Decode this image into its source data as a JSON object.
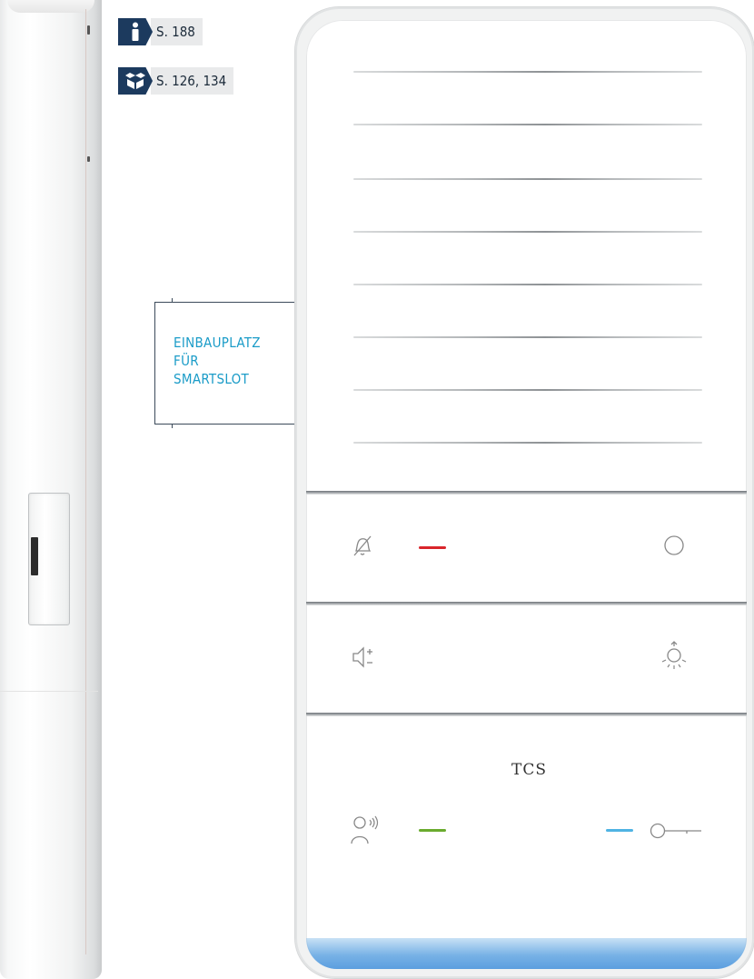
{
  "refs": [
    {
      "icon": "info-icon",
      "text": "S. 188"
    },
    {
      "icon": "package-icon",
      "text": "S. 126, 134"
    }
  ],
  "callout": {
    "label": "EINBAUPLATZ\nFÜR\nSMARTSLOT"
  },
  "device": {
    "brand": "TCS",
    "buttons": [
      {
        "icon": "bell-mute-icon",
        "led_color": "#d9252b",
        "status": ""
      },
      {
        "icon": "circle-icon"
      },
      {
        "icon": "volume-icon"
      },
      {
        "icon": "light-icon"
      },
      {
        "icon": "talk-icon",
        "led_color": "#6aab2e"
      },
      {
        "icon": "door-key-icon",
        "led_color": "#4fb3e3"
      }
    ],
    "accent_glow": "#78b2e6"
  }
}
